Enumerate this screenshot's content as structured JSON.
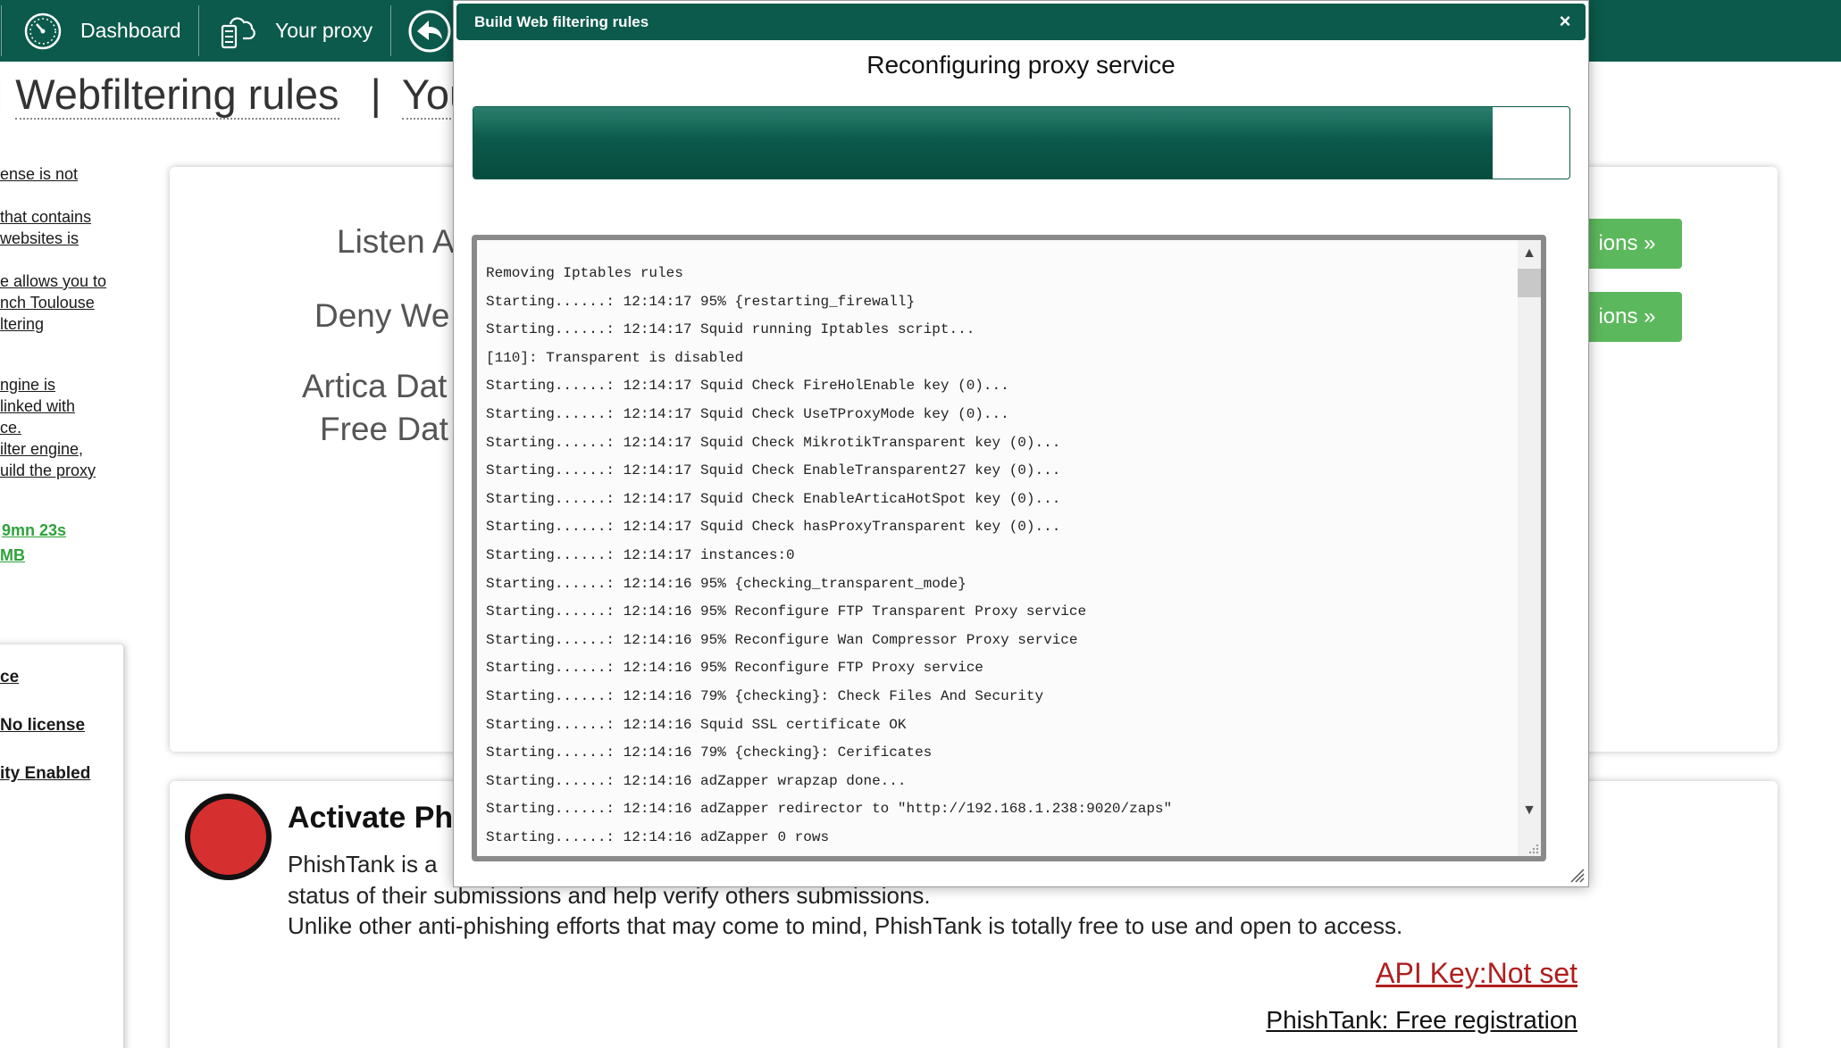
{
  "nav": {
    "dashboard_label": "Dashboard",
    "your_proxy_label": "Your proxy"
  },
  "page": {
    "title_part1": "Webfiltering rules",
    "title_sep": "|",
    "title_part2": "You"
  },
  "sidebar_links": [
    "ense is not",
    "that contains",
    "websites is",
    "e allows you to",
    "nch Toulouse",
    "ltering",
    "ngine is",
    "linked with",
    "ce.",
    "ilter engine,",
    "uild the proxy"
  ],
  "sidebar_stats": {
    "uptime": "9mn 23s",
    "size": "MB"
  },
  "left_panel": {
    "link1": "ce",
    "link2": "No license",
    "link3": "ity Enabled"
  },
  "main": {
    "listen_label": "Listen A",
    "deny_label": "Deny We",
    "artica_label": "Artica Dat",
    "free_label": "Free Dat",
    "button1": "ions »",
    "button2": "ions »"
  },
  "phishtank": {
    "title": "Activate Ph",
    "line1": "PhishTank is a",
    "line2": "status of their submissions and help verify others submissions.",
    "line3": "Unlike other anti-phishing efforts that may come to mind, PhishTank is totally free to use and open to access.",
    "api_key_link": "API Key:Not set",
    "registration_link": "PhishTank: Free registration",
    "status_color": "#d62f2f"
  },
  "modal": {
    "title": "Build Web filtering rules",
    "close_label": "×",
    "heading": "Reconfiguring proxy service",
    "progress_percent": 93,
    "log_lines": [
      "Removing Iptables rules",
      "Starting......: 12:14:17 95% {restarting_firewall}",
      "Starting......: 12:14:17 Squid running Iptables script...",
      "[110]: Transparent is disabled",
      "Starting......: 12:14:17 Squid Check FireHolEnable key (0)...",
      "Starting......: 12:14:17 Squid Check UseTProxyMode key (0)...",
      "Starting......: 12:14:17 Squid Check MikrotikTransparent key (0)...",
      "Starting......: 12:14:17 Squid Check EnableTransparent27 key (0)...",
      "Starting......: 12:14:17 Squid Check EnableArticaHotSpot key (0)...",
      "Starting......: 12:14:17 Squid Check hasProxyTransparent key (0)...",
      "Starting......: 12:14:17 instances:0",
      "Starting......: 12:14:16 95% {checking_transparent_mode}",
      "Starting......: 12:14:16 95% Reconfigure FTP Transparent Proxy service",
      "Starting......: 12:14:16 95% Reconfigure Wan Compressor Proxy service",
      "Starting......: 12:14:16 95% Reconfigure FTP Proxy service",
      "Starting......: 12:14:16 79% {checking}: Check Files And Security",
      "Starting......: 12:14:16 Squid SSL certificate OK",
      "Starting......: 12:14:16 79% {checking}: Cerificates",
      "Starting......: 12:14:16 adZapper wrapzap done...",
      "Starting......: 12:14:16 adZapper redirector to \"http://192.168.1.238:9020/zaps\"",
      "Starting......: 12:14:16 adZapper 0 rows"
    ]
  },
  "colors": {
    "brand_green": "#0b5a4b",
    "button_green": "#5cb85c",
    "link_red": "#b01e1e"
  }
}
